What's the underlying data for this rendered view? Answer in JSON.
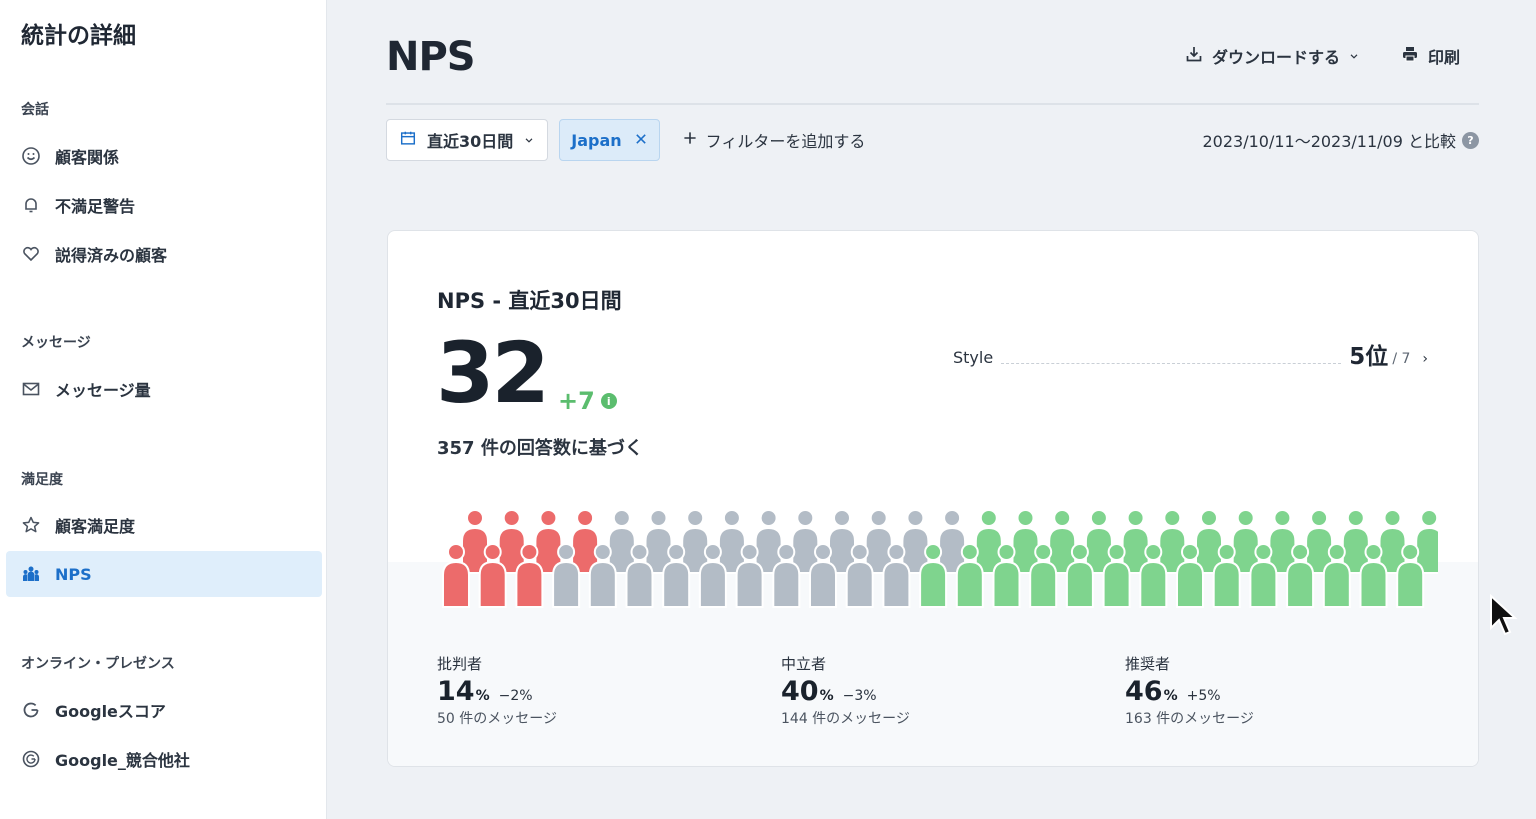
{
  "sidebar": {
    "title": "統計の詳細",
    "sections": [
      {
        "label": "会話",
        "items": [
          {
            "label": "顧客関係",
            "icon": "smile-icon"
          },
          {
            "label": "不満足警告",
            "icon": "bell-icon"
          },
          {
            "label": "説得済みの顧客",
            "icon": "heart-icon"
          }
        ]
      },
      {
        "label": "メッセージ",
        "items": [
          {
            "label": "メッセージ量",
            "icon": "mail-icon"
          }
        ]
      },
      {
        "label": "満足度",
        "items": [
          {
            "label": "顧客満足度",
            "icon": "star-icon"
          },
          {
            "label": "NPS",
            "icon": "nps-icon",
            "active": true
          }
        ]
      },
      {
        "label": "オンライン・プレゼンス",
        "items": [
          {
            "label": "Googleスコア",
            "icon": "google-icon"
          },
          {
            "label": "Google_競合他社",
            "icon": "google-competitor-icon"
          }
        ]
      }
    ]
  },
  "header": {
    "title": "NPS",
    "download_label": "ダウンロードする",
    "print_label": "印刷"
  },
  "filters": {
    "date_range": "直近30日間",
    "chip": "Japan",
    "add_filter": "フィルターを追加する",
    "compare": "2023/10/11〜2023/11/09 と比較"
  },
  "card": {
    "title": "NPS - 直近30日間",
    "score": "32",
    "delta": "+7",
    "based_on": "357 件の回答数に基づく",
    "rank": {
      "label": "Style",
      "value": "5位",
      "of": "/ 7"
    },
    "colors": {
      "detractor": "#ec6b6b",
      "passive": "#b3bcc6",
      "promoter": "#7fd48e"
    },
    "people": {
      "detractors": 7,
      "passives": 20,
      "promoters": 27
    },
    "stats": [
      {
        "label": "批判者",
        "value": "14",
        "unit": "%",
        "change": "−2%",
        "messages": "50 件のメッセージ"
      },
      {
        "label": "中立者",
        "value": "40",
        "unit": "%",
        "change": "−3%",
        "messages": "144 件のメッセージ"
      },
      {
        "label": "推奨者",
        "value": "46",
        "unit": "%",
        "change": "+5%",
        "messages": "163 件のメッセージ"
      }
    ]
  }
}
